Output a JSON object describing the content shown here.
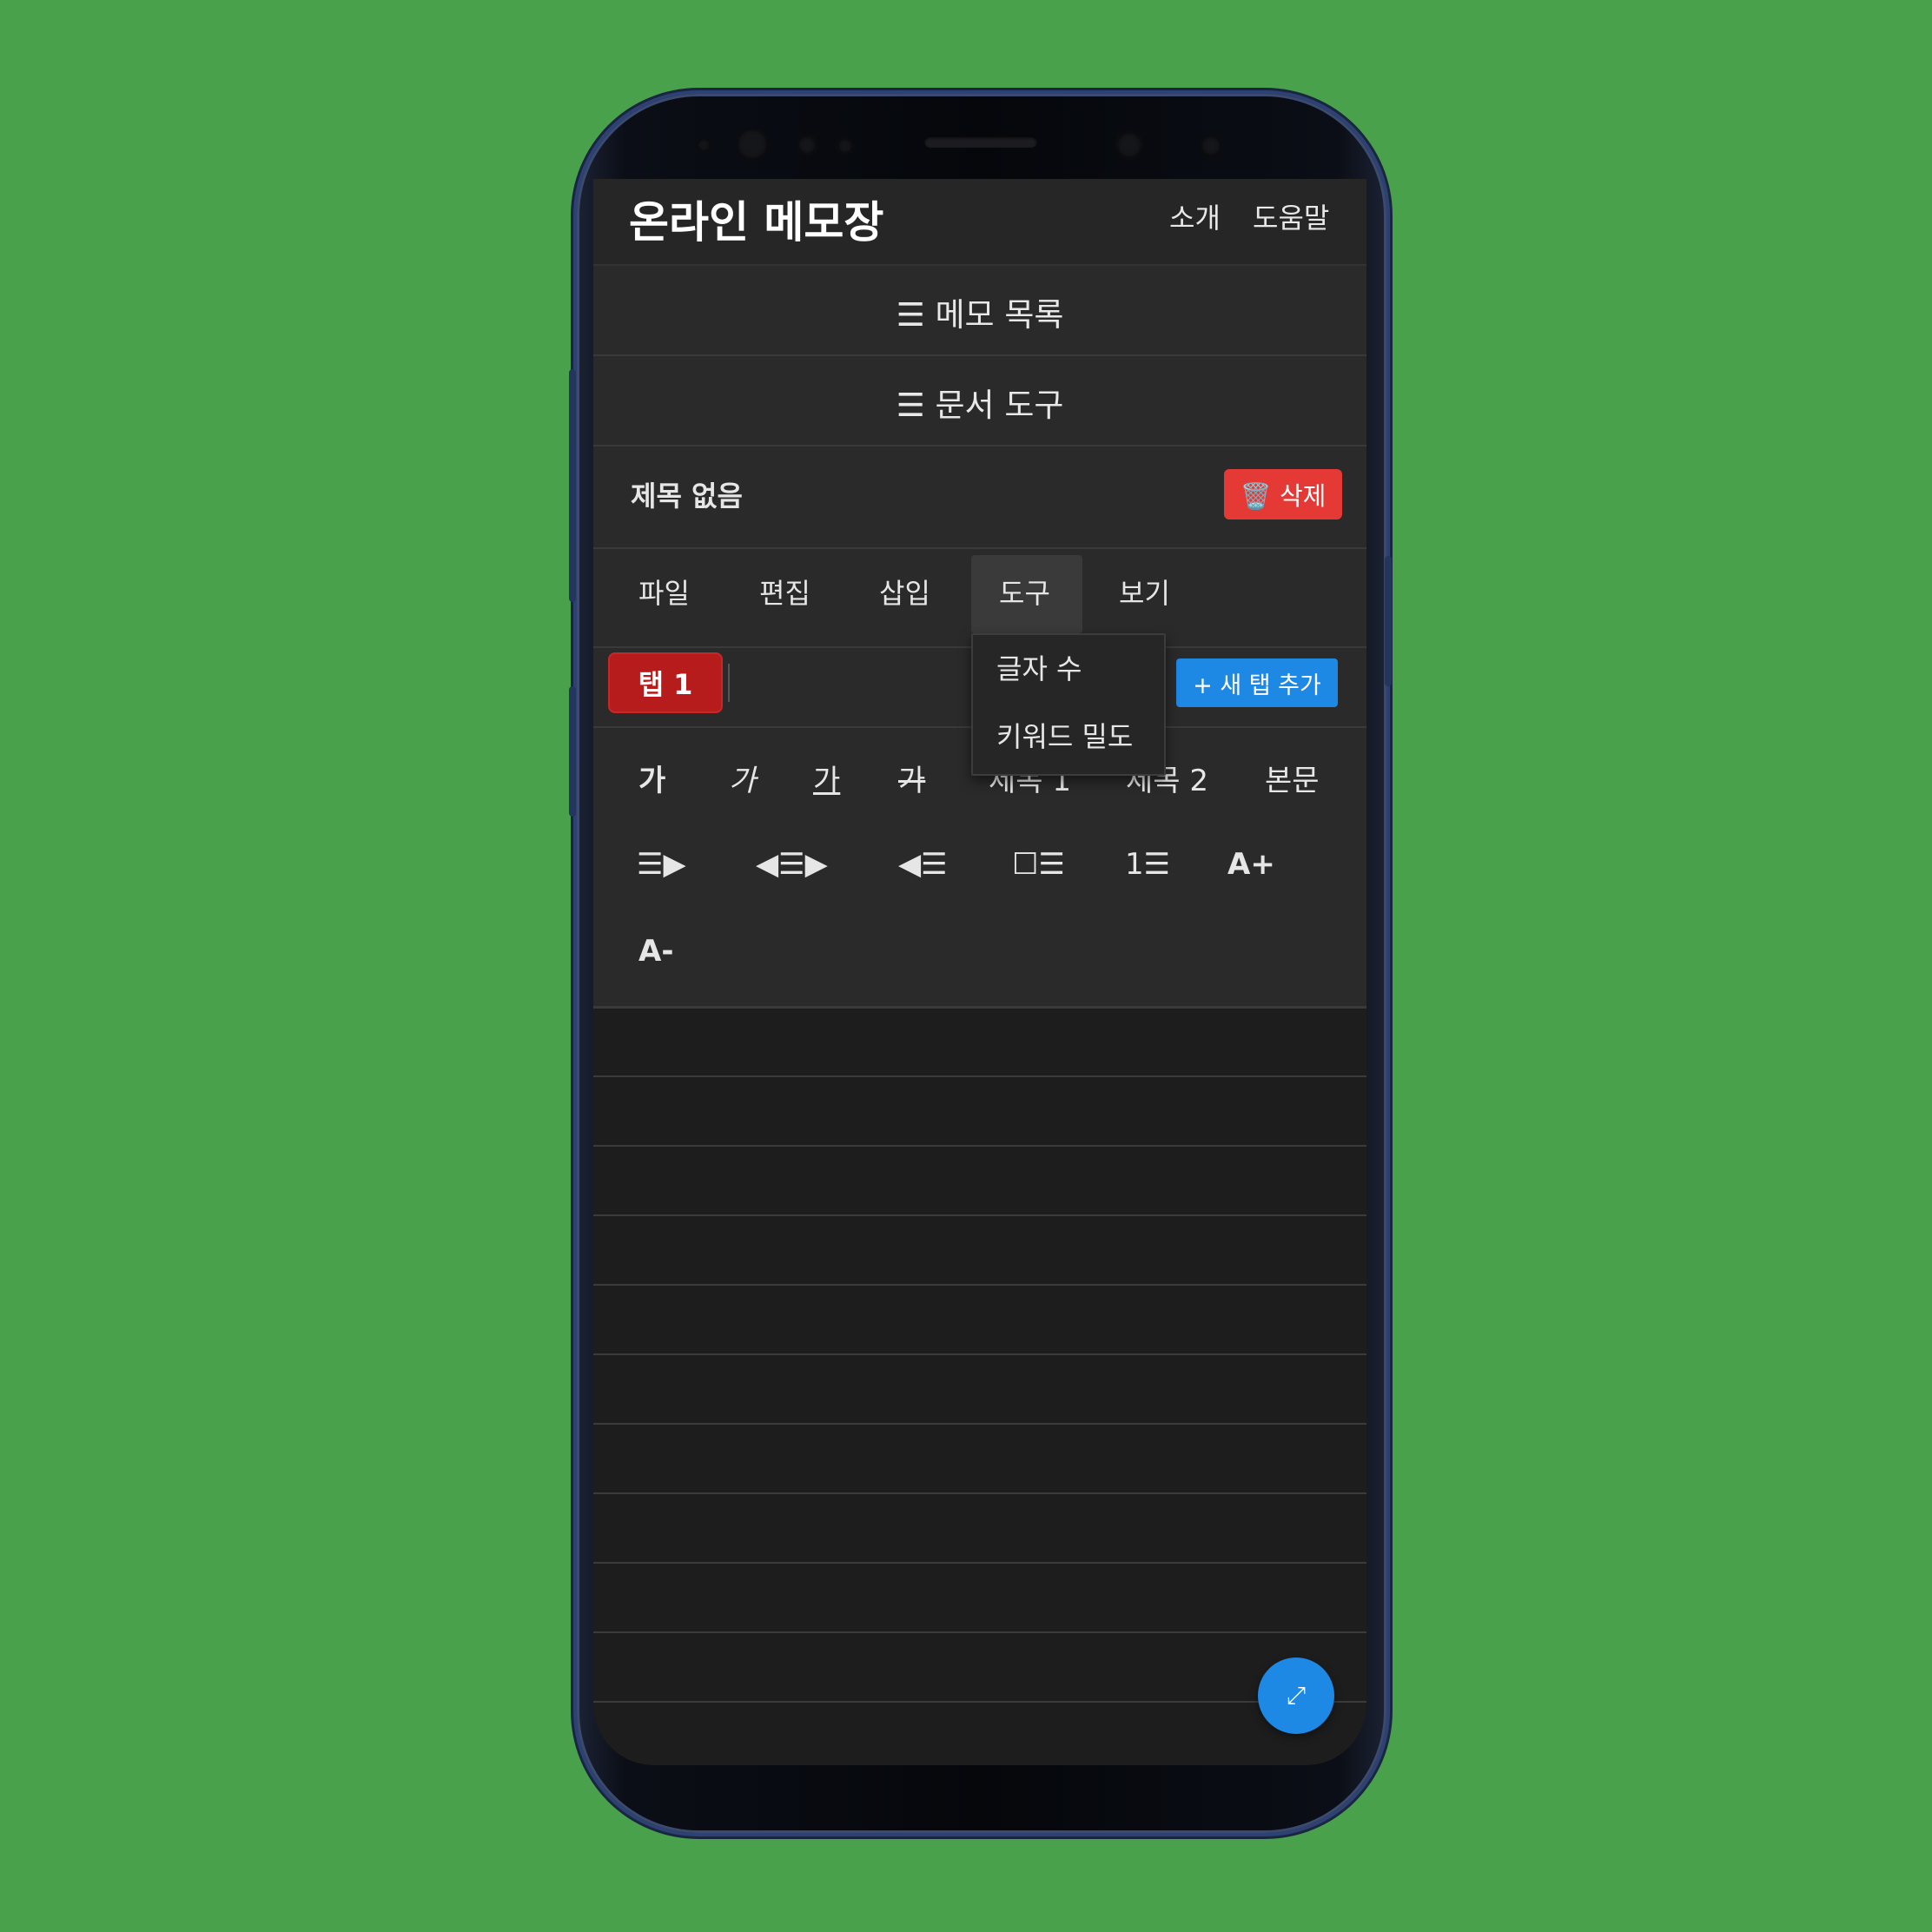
{
  "app": {
    "title": "온라인 메모장",
    "nav": [
      "소개",
      "도움말"
    ]
  },
  "sections": {
    "memo_list": "☰ 메모 목록",
    "doc_tools": "☰ 문서 도구"
  },
  "memo": {
    "title": "제목 없음",
    "delete_label": "🗑️ 삭제"
  },
  "menubar": {
    "items": [
      "파일",
      "편집",
      "삽입",
      "도구",
      "보기"
    ],
    "active": "도구",
    "dropdown": [
      "글자 수",
      "키워드 밀도"
    ]
  },
  "tabs": {
    "items": [
      "탭 1"
    ],
    "new_tab_label": "+ 새 탭 추가"
  },
  "format_row1": [
    "가",
    "가",
    "가",
    "가",
    "제목 1",
    "제목 2",
    "본문"
  ],
  "format_row2": [
    "☰▶",
    "◀☰▶",
    "◀☰",
    "☐☰",
    "1☰",
    "A+"
  ],
  "format_row3": [
    "A-"
  ],
  "fab": {
    "icon": "expand-icon",
    "glyph": "⤢"
  },
  "colors": {
    "background": "#49a14c",
    "danger": "#e53935",
    "active_tab": "#b71c1c",
    "accent": "#1e88e5"
  }
}
